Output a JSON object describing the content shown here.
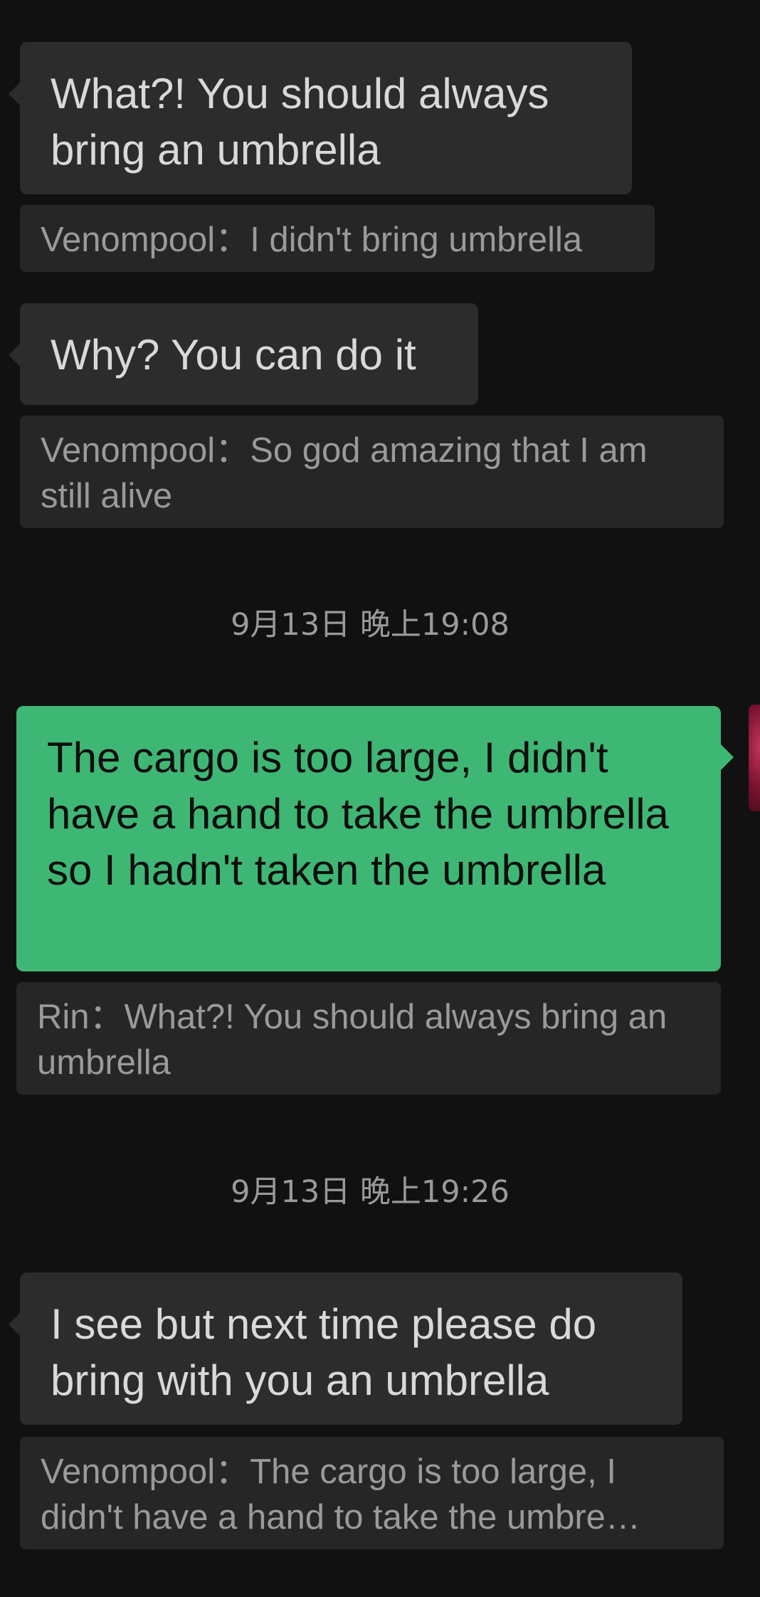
{
  "messages": [
    {
      "direction": "incoming",
      "text": "What?! You should always bring an umbrella",
      "quote": "Venompool：I didn't bring umbrella"
    },
    {
      "direction": "incoming",
      "text": "Why? You can do it",
      "quote": "Venompool：So god amazing that I am still alive"
    },
    {
      "timestamp": "9月13日 晚上19:08"
    },
    {
      "direction": "outgoing",
      "text": "The cargo is too large, I didn't have a hand to take the umbrella so I hadn't taken the umbrella",
      "quote": "Rin：What?! You should always bring an umbrella"
    },
    {
      "timestamp": "9月13日 晚上19:26"
    },
    {
      "direction": "incoming",
      "text": "I see but next time please do bring with you an umbrella",
      "quote": "Venompool：The cargo is too large, I didn't have a hand to take the umbre…"
    }
  ],
  "colors": {
    "background": "#111111",
    "incoming_bubble": "#2c2c2c",
    "outgoing_bubble": "#3fb774",
    "quote_background": "#262626",
    "quote_text": "#9a9a9a"
  }
}
